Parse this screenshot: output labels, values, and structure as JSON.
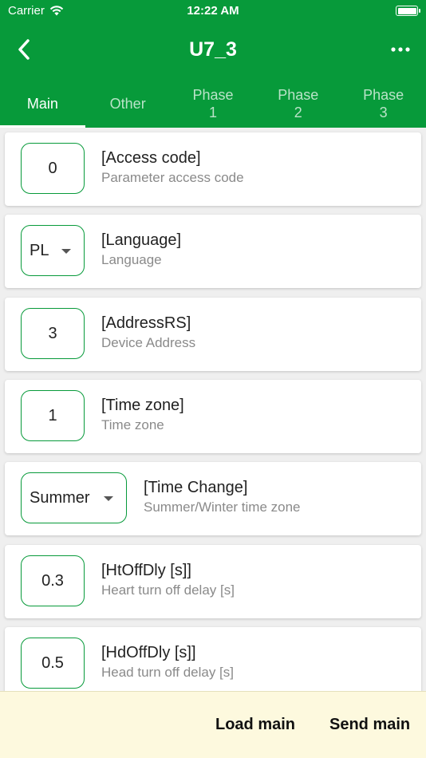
{
  "status_bar": {
    "carrier": "Carrier",
    "time": "12:22 AM",
    "battery_level": 1.0
  },
  "nav": {
    "title": "U7_3",
    "back_icon": "chevron-left-icon",
    "more_icon": "more-horizontal-icon"
  },
  "tabs": [
    {
      "label": "Main",
      "active": true
    },
    {
      "label": "Other",
      "active": false
    },
    {
      "label": "Phase\n1",
      "active": false
    },
    {
      "label": "Phase\n2",
      "active": false
    },
    {
      "label": "Phase\n3",
      "active": false
    }
  ],
  "params": [
    {
      "value": "0",
      "kind": "input",
      "title": "[Access code]",
      "subtitle": "Parameter access code"
    },
    {
      "value": "PL",
      "kind": "select",
      "title": "[Language]",
      "subtitle": "Language"
    },
    {
      "value": "3",
      "kind": "input",
      "title": "[AddressRS]",
      "subtitle": "Device Address"
    },
    {
      "value": "1",
      "kind": "input",
      "title": "[Time zone]",
      "subtitle": "Time zone"
    },
    {
      "value": "Summer",
      "kind": "select",
      "title": "[Time Change]",
      "subtitle": "Summer/Winter time zone"
    },
    {
      "value": "0.3",
      "kind": "input",
      "title": "[HtOffDly [s]]",
      "subtitle": "Heart turn off delay [s]"
    },
    {
      "value": "0.5",
      "kind": "input",
      "title": "[HdOffDly [s]]",
      "subtitle": "Head turn off delay [s]"
    }
  ],
  "footer": {
    "load_label": "Load main",
    "send_label": "Send main"
  },
  "colors": {
    "primary": "#079a3a",
    "footer_bg": "#fdf9de"
  }
}
